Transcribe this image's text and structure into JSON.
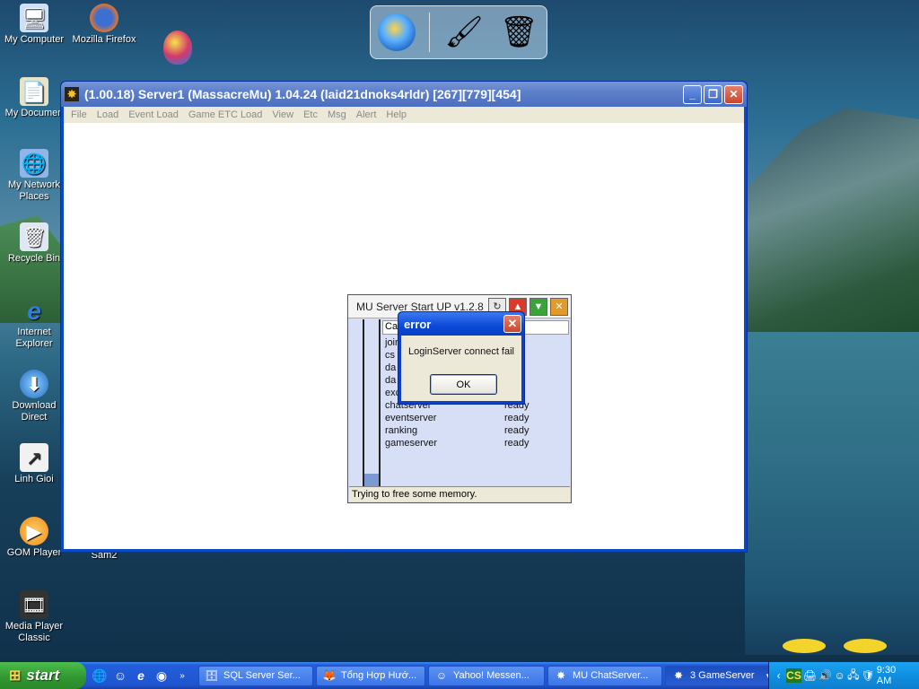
{
  "desktop": {
    "icons": [
      {
        "label": "My Computer",
        "icon": "computer-icon"
      },
      {
        "label": "Mozilla Firefox",
        "icon": "firefox-icon"
      },
      {
        "label": "My Documen",
        "icon": "documents-icon"
      },
      {
        "label": "My Network Places",
        "icon": "network-icon"
      },
      {
        "label": "Recycle Bin",
        "icon": "recycle-bin-icon"
      },
      {
        "label": "Internet Explorer",
        "icon": "ie-icon"
      },
      {
        "label": "Download Direct",
        "icon": "download-icon"
      },
      {
        "label": "Linh Gioi",
        "icon": "shortcut-icon"
      },
      {
        "label": "GOM Player",
        "icon": "gom-player-icon"
      },
      {
        "label": "Sam2",
        "icon": "shortcut-icon"
      },
      {
        "label": "Media Player Classic",
        "icon": "media-player-icon"
      }
    ]
  },
  "dock": {
    "items": [
      "ie-globe-icon",
      "brushes-icon",
      "recycle-bin-icon"
    ]
  },
  "main_window": {
    "title": "(1.00.18) Server1 (MassacreMu) 1.04.24 (laid21dnoks4rldr) [267][779][454]",
    "menu": [
      "File",
      "Load",
      "Event Load",
      "Game ETC Load",
      "View",
      "Etc",
      "Msg",
      "Alert",
      "Help"
    ]
  },
  "mu_window": {
    "title": "MU Server Start UP v1.2.8",
    "header": "Ca",
    "rows": [
      {
        "name": "joir",
        "status": ""
      },
      {
        "name": "cs",
        "status": ""
      },
      {
        "name": "da",
        "status": ""
      },
      {
        "name": "da",
        "status": ""
      },
      {
        "name": "exc",
        "status": ""
      },
      {
        "name": "chatserver",
        "status": "ready"
      },
      {
        "name": "eventserver",
        "status": "ready"
      },
      {
        "name": "ranking",
        "status": "ready"
      },
      {
        "name": "gameserver",
        "status": "ready"
      }
    ],
    "status_text": "Trying to free some memory."
  },
  "error_dialog": {
    "title": "error",
    "message": "LoginServer connect fail",
    "ok_label": "OK"
  },
  "taskbar": {
    "start_label": "start",
    "tasks": [
      {
        "label": "SQL Server Ser...",
        "icon": "sql-server-icon"
      },
      {
        "label": "Tổng Hợp Hướ...",
        "icon": "firefox-icon"
      },
      {
        "label": "Yahoo! Messen...",
        "icon": "yahoo-icon"
      },
      {
        "label": "MU ChatServer...",
        "icon": "mu-icon"
      },
      {
        "label": "3 GameServer",
        "icon": "mu-icon"
      }
    ],
    "tray_badge": "CS",
    "clock": "9:30 AM"
  }
}
